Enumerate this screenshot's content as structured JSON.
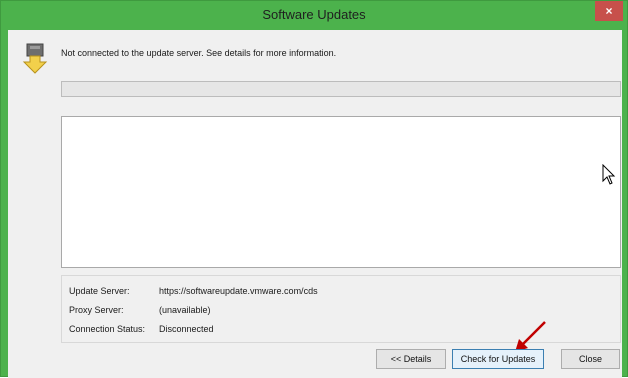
{
  "window": {
    "title": "Software Updates",
    "close_glyph": "×"
  },
  "status": {
    "icon": "download-package-icon",
    "message": "Not connected to the update server. See details for more information."
  },
  "info": {
    "update_server_label": "Update Server:",
    "update_server_value": "https://softwareupdate.vmware.com/cds",
    "proxy_server_label": "Proxy Server:",
    "proxy_server_value": "(unavailable)",
    "connection_status_label": "Connection Status:",
    "connection_status_value": "Disconnected"
  },
  "buttons": {
    "details": "<< Details",
    "check_updates": "Check for Updates",
    "close": "Close"
  },
  "colors": {
    "titlebar": "#4cb24c",
    "close_button": "#c7504b",
    "arrow": "#c00000"
  }
}
